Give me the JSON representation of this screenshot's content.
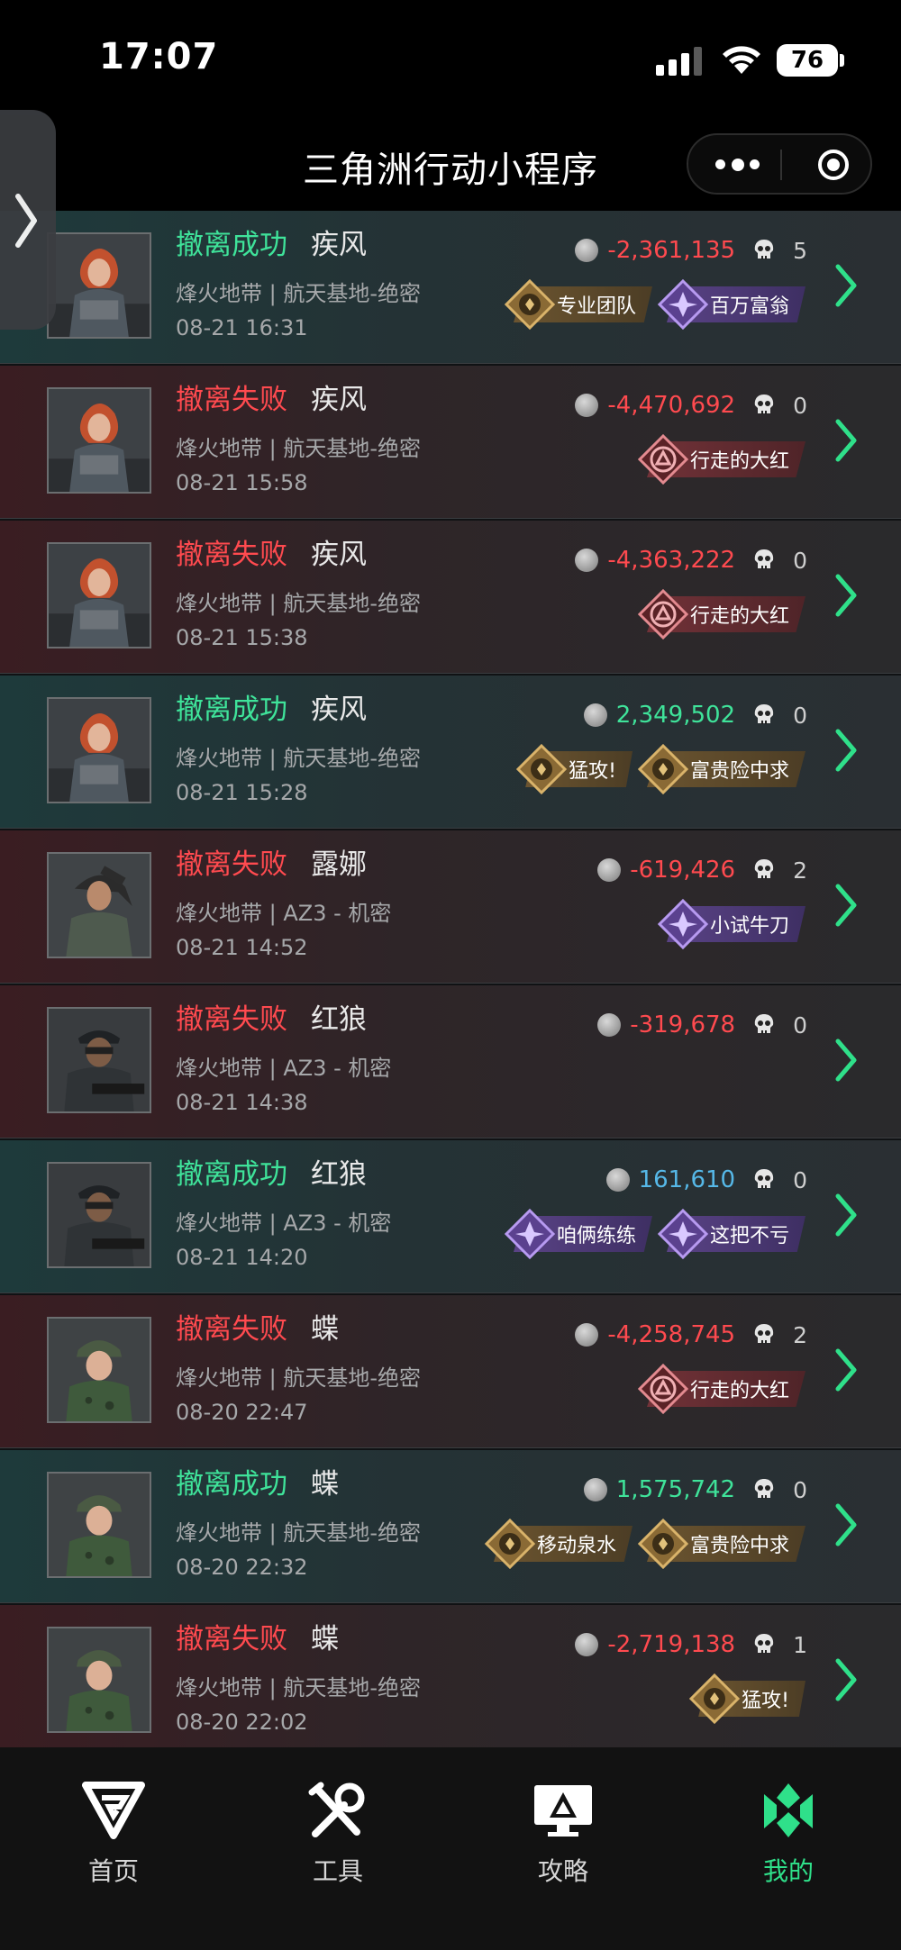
{
  "status_bar": {
    "time": "17:07",
    "battery": "76"
  },
  "nav": {
    "title": "三角洲行动小程序"
  },
  "records": [
    {
      "result": "撤离成功",
      "status": "success",
      "operator": "疾风",
      "map": "烽火地带 | 航天基地-绝密",
      "time": "08-21 16:31",
      "value": "-2,361,135",
      "value_color": "neg",
      "kills": "5",
      "portrait": "hawk",
      "badges": [
        {
          "label": "专业团队",
          "tone": "gold"
        },
        {
          "label": "百万富翁",
          "tone": "purple"
        }
      ]
    },
    {
      "result": "撤离失败",
      "status": "fail",
      "operator": "疾风",
      "map": "烽火地带 | 航天基地-绝密",
      "time": "08-21 15:58",
      "value": "-4,470,692",
      "value_color": "neg",
      "kills": "0",
      "portrait": "hawk",
      "badges": [
        {
          "label": "行走的大红",
          "tone": "red"
        }
      ]
    },
    {
      "result": "撤离失败",
      "status": "fail",
      "operator": "疾风",
      "map": "烽火地带 | 航天基地-绝密",
      "time": "08-21 15:38",
      "value": "-4,363,222",
      "value_color": "neg",
      "kills": "0",
      "portrait": "hawk",
      "badges": [
        {
          "label": "行走的大红",
          "tone": "red"
        }
      ]
    },
    {
      "result": "撤离成功",
      "status": "success",
      "operator": "疾风",
      "map": "烽火地带 | 航天基地-绝密",
      "time": "08-21 15:28",
      "value": "2,349,502",
      "value_color": "pos-green",
      "kills": "0",
      "portrait": "hawk",
      "badges": [
        {
          "label": "猛攻!",
          "tone": "gold"
        },
        {
          "label": "富贵险中求",
          "tone": "gold"
        }
      ]
    },
    {
      "result": "撤离失败",
      "status": "fail",
      "operator": "露娜",
      "map": "烽火地带 | AZ3 - 机密",
      "time": "08-21 14:52",
      "value": "-619,426",
      "value_color": "neg",
      "kills": "2",
      "portrait": "luna",
      "badges": [
        {
          "label": "小试牛刀",
          "tone": "purple"
        }
      ]
    },
    {
      "result": "撤离失败",
      "status": "fail",
      "operator": "红狼",
      "map": "烽火地带 | AZ3 - 机密",
      "time": "08-21 14:38",
      "value": "-319,678",
      "value_color": "neg",
      "kills": "0",
      "portrait": "wolf",
      "badges": []
    },
    {
      "result": "撤离成功",
      "status": "success",
      "operator": "红狼",
      "map": "烽火地带 | AZ3 - 机密",
      "time": "08-21 14:20",
      "value": "161,610",
      "value_color": "pos-blue",
      "kills": "0",
      "portrait": "wolf",
      "badges": [
        {
          "label": "咱俩练练",
          "tone": "purple"
        },
        {
          "label": "这把不亏",
          "tone": "purple"
        }
      ]
    },
    {
      "result": "撤离失败",
      "status": "fail",
      "operator": "蝶",
      "map": "烽火地带 | 航天基地-绝密",
      "time": "08-20 22:47",
      "value": "-4,258,745",
      "value_color": "neg",
      "kills": "2",
      "portrait": "butterfly",
      "badges": [
        {
          "label": "行走的大红",
          "tone": "red"
        }
      ]
    },
    {
      "result": "撤离成功",
      "status": "success",
      "operator": "蝶",
      "map": "烽火地带 | 航天基地-绝密",
      "time": "08-20 22:32",
      "value": "1,575,742",
      "value_color": "pos-green",
      "kills": "0",
      "portrait": "butterfly",
      "badges": [
        {
          "label": "移动泉水",
          "tone": "gold"
        },
        {
          "label": "富贵险中求",
          "tone": "gold"
        }
      ]
    },
    {
      "result": "撤离失败",
      "status": "fail",
      "operator": "蝶",
      "map": "烽火地带 | 航天基地-绝密",
      "time": "08-20 22:02",
      "value": "-2,719,138",
      "value_color": "neg",
      "kills": "1",
      "portrait": "butterfly",
      "badges": [
        {
          "label": "猛攻!",
          "tone": "gold"
        }
      ]
    }
  ],
  "tabs": [
    {
      "label": "首页",
      "icon": "home-logo-icon",
      "active": false
    },
    {
      "label": "工具",
      "icon": "tools-icon",
      "active": false
    },
    {
      "label": "攻略",
      "icon": "guide-monitor-icon",
      "active": false
    },
    {
      "label": "我的",
      "icon": "profile-icon",
      "active": true
    }
  ],
  "colors": {
    "success": "#3fe39a",
    "fail": "#ff4a4f",
    "accent": "#2fe08a",
    "positive_blue": "#56b8e8"
  }
}
